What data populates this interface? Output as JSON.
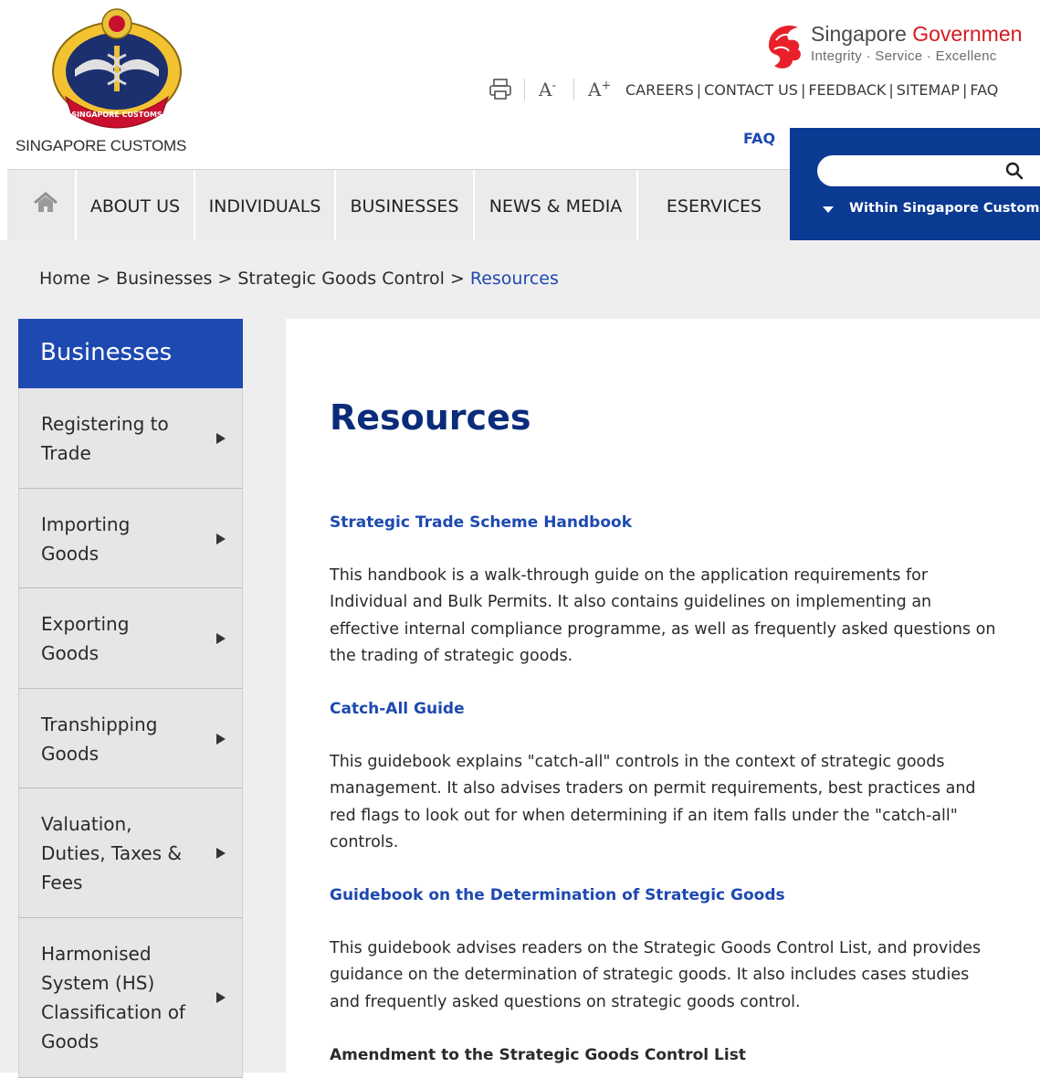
{
  "header": {
    "agency_name": "SINGAPORE CUSTOMS",
    "crest_icon": "singapore-customs-crest-icon",
    "crest_ribbon_text": "SINGAPORE CUSTOMS",
    "gov_brand": {
      "title_part1": "Singapore ",
      "title_part2": "Governmen",
      "tagline": "Integrity · Service · Excellenc",
      "lion_icon": "lion-head-icon"
    },
    "utility": {
      "print_icon": "printer-icon",
      "font_decrease": "A",
      "font_decrease_sup": "-",
      "font_increase": "A",
      "font_increase_sup": "+",
      "links": [
        "CAREERS",
        "CONTACT US",
        "FEEDBACK",
        "SITEMAP",
        "FAQ"
      ]
    },
    "faq_label": "FAQ"
  },
  "nav": {
    "home_icon": "home-icon",
    "items": [
      "ABOUT US",
      "INDIVIDUALS",
      "BUSINESSES",
      "NEWS & MEDIA",
      "ESERVICES"
    ]
  },
  "search": {
    "placeholder": "",
    "icon": "search-icon",
    "scope_label": "Within Singapore Customs",
    "scope_icon": "caret-down-icon"
  },
  "breadcrumb": {
    "items": [
      "Home",
      "Businesses",
      "Strategic Goods Control"
    ],
    "separator": ">",
    "current": "Resources"
  },
  "sidebar": {
    "title": "Businesses",
    "arrow_icon": "arrow-right-icon",
    "items": [
      {
        "line1": "Registering to",
        "line2": "Trade"
      },
      {
        "line1": "Importing",
        "line2": "Goods"
      },
      {
        "line1": "Exporting",
        "line2": "Goods"
      },
      {
        "line1": "Transhipping",
        "line2": "Goods"
      },
      {
        "line1": "Valuation,",
        "line2": "Duties, Taxes &",
        "line3": "Fees"
      },
      {
        "line1": "Harmonised",
        "line2": "System (HS)",
        "line3": "Classification of",
        "line4": "Goods"
      }
    ]
  },
  "main": {
    "title": "Resources",
    "resources": [
      {
        "title": "Strategic Trade Scheme Handbook",
        "description": "This handbook is a walk-through guide on the application requirements for Individual and Bulk Permits. It also contains guidelines on implementing an effective internal compliance programme, as well as frequently asked questions on the trading of strategic goods."
      },
      {
        "title": "Catch-All Guide",
        "description": "This guidebook explains \"catch-all\" controls in the context of strategic goods management. It also advises traders on permit requirements, best practices and red flags to look out for when determining if an item falls under the \"catch-all\" controls."
      },
      {
        "title": "Guidebook on the Determination of Strategic Goods",
        "description": "This guidebook advises readers on the Strategic Goods Control List, and provides guidance on the determination of strategic goods. It also includes cases studies and frequently asked questions on strategic goods control."
      }
    ],
    "amendment_heading": "Amendment to the Strategic Goods Control List"
  },
  "colors": {
    "brand_blue": "#1d49b1",
    "dark_blue": "#0b3a93",
    "title_blue": "#0b2c7a",
    "gov_red": "#d71920",
    "nav_bg": "#ebebeb",
    "page_bg": "#eeeeee"
  }
}
